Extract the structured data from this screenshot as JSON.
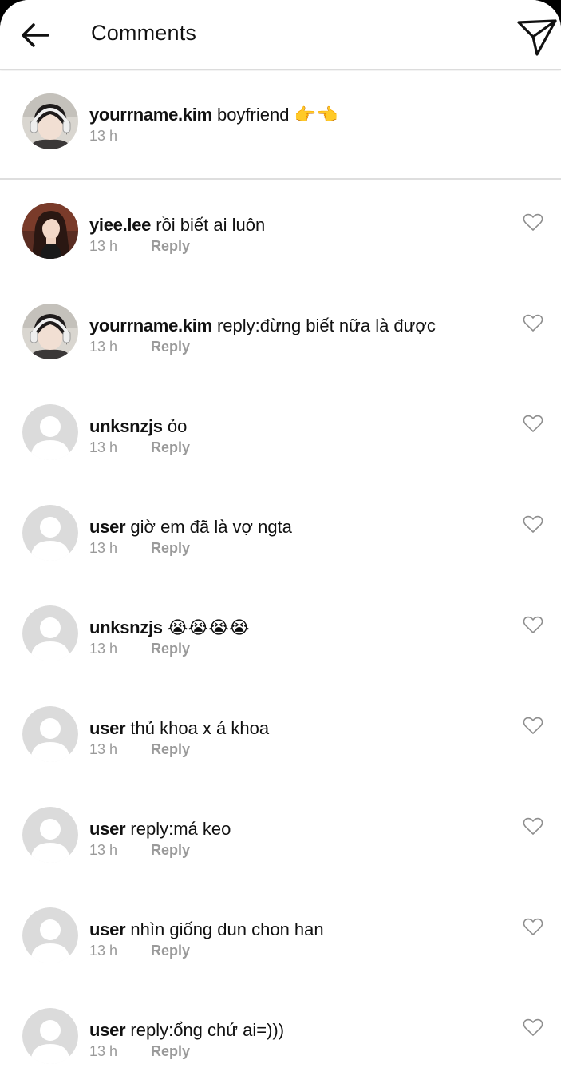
{
  "header": {
    "title": "Comments",
    "back_icon": "arrow-left-icon",
    "send_icon": "paper-plane-icon"
  },
  "caption": {
    "username": "yourrname.kim",
    "text": "boyfriend 👉👈",
    "time": "13 h"
  },
  "reply_label": "Reply",
  "comments": [
    {
      "username": "yiee.lee",
      "text": "rồi biết ai luôn",
      "time": "13 h",
      "avatar": "photo-girl"
    },
    {
      "username": "yourrname.kim",
      "text": "reply:đừng biết nữa là được",
      "time": "13 h",
      "avatar": "photo-headphones"
    },
    {
      "username": "unksnzjs",
      "text": "ỏo",
      "time": "13 h",
      "avatar": "default"
    },
    {
      "username": "user",
      "text": "giờ em đã là vợ ngta",
      "time": "13 h",
      "avatar": "default"
    },
    {
      "username": "unksnzjs",
      "text": "😭😭😭😭",
      "time": "13 h",
      "avatar": "default"
    },
    {
      "username": "user",
      "text": "thủ khoa x á khoa",
      "time": "13 h",
      "avatar": "default"
    },
    {
      "username": "user",
      "text": "reply:má keo",
      "time": "13 h",
      "avatar": "default"
    },
    {
      "username": "user",
      "text": "nhìn giống dun chon han",
      "time": "13 h",
      "avatar": "default"
    },
    {
      "username": "user",
      "text": "reply:ổng chứ ai=)))",
      "time": "13 h",
      "avatar": "default"
    }
  ],
  "colors": {
    "text": "#111111",
    "muted": "#9a9a9a",
    "divider": "#dedede",
    "default_avatar": "#dbdbdb"
  }
}
